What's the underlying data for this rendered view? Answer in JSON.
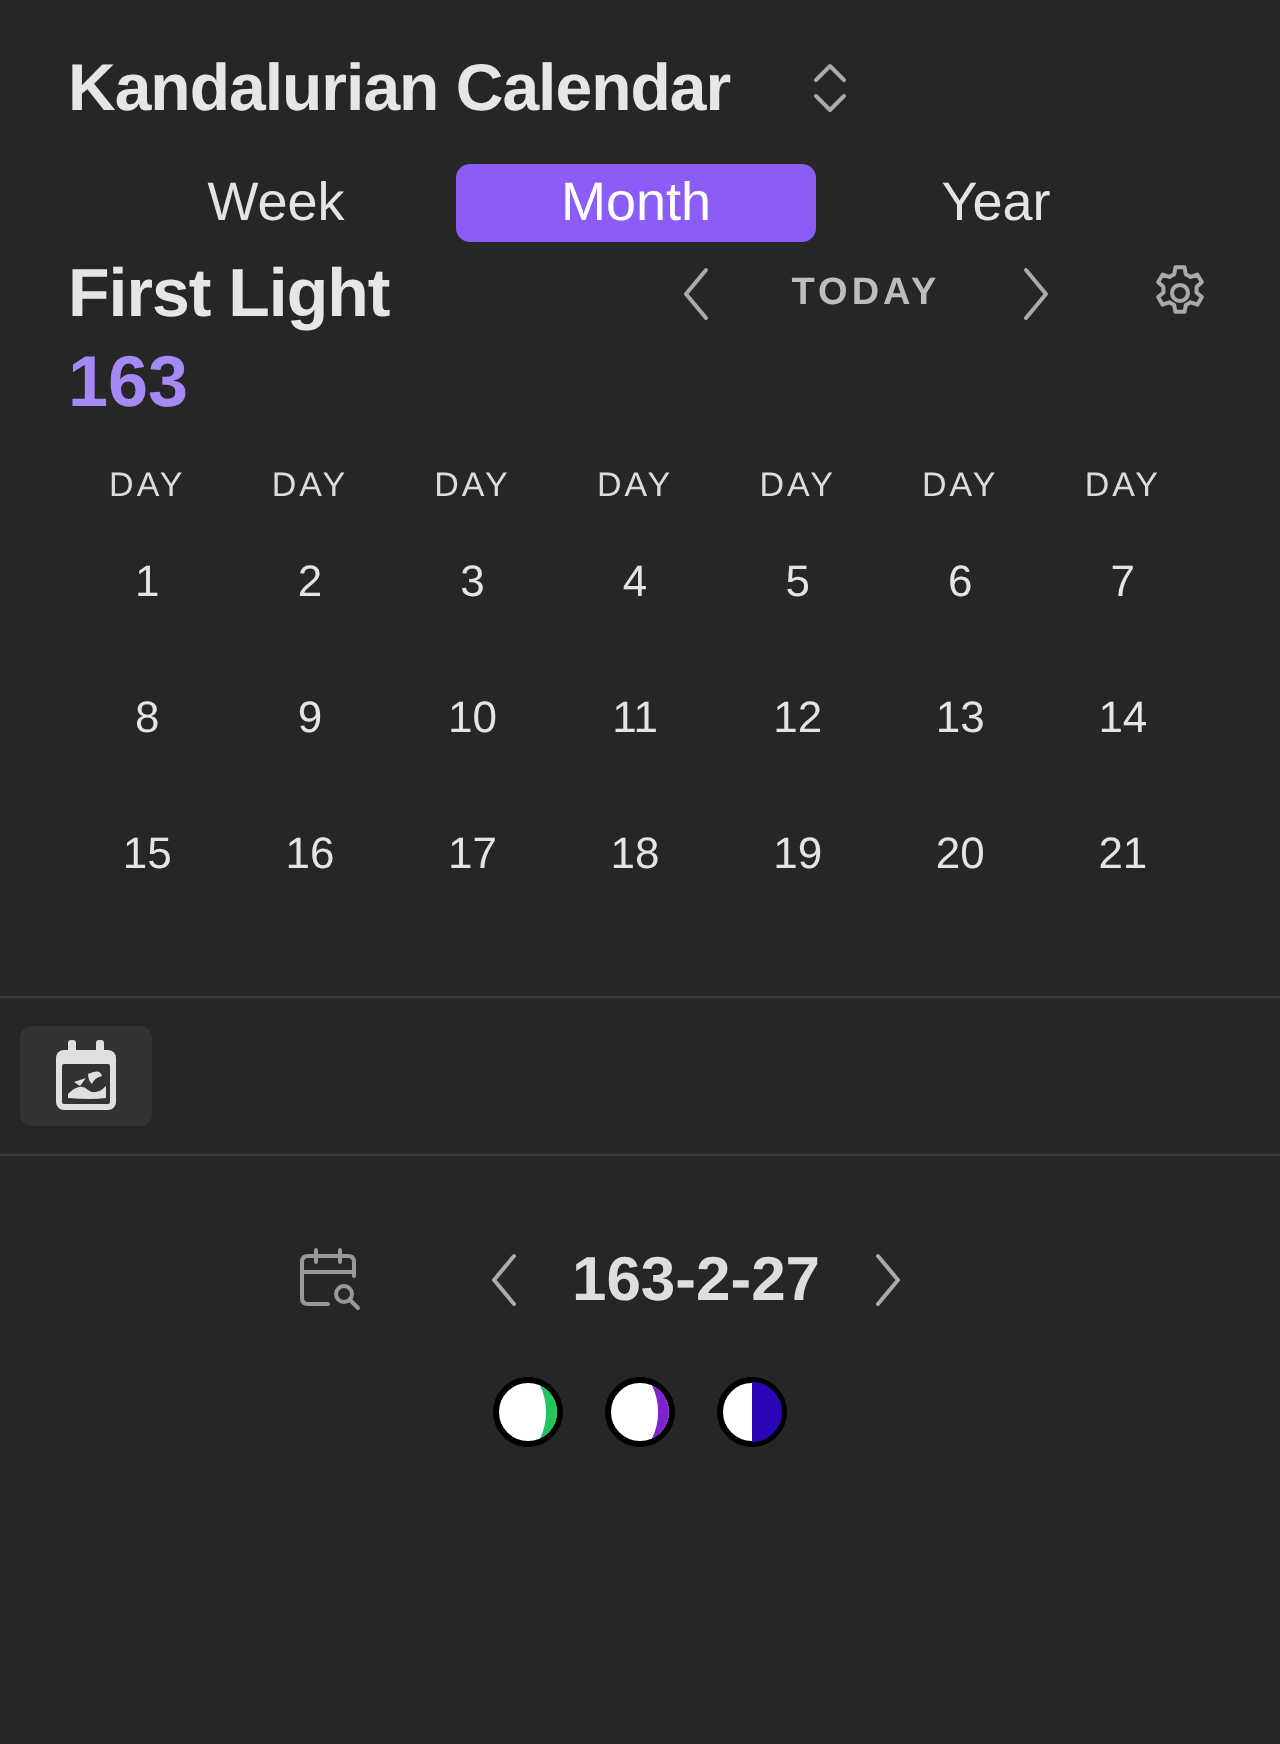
{
  "header": {
    "title": "Kandalurian Calendar"
  },
  "tabs": [
    {
      "label": "Week",
      "selected": false
    },
    {
      "label": "Month",
      "selected": true
    },
    {
      "label": "Year",
      "selected": false
    }
  ],
  "month": {
    "name": "First Light",
    "year": "163",
    "today_label": "TODAY"
  },
  "calendar": {
    "weekdays": [
      "DAY",
      "DAY",
      "DAY",
      "DAY",
      "DAY",
      "DAY",
      "DAY"
    ],
    "weeks": [
      [
        "1",
        "2",
        "3",
        "4",
        "5",
        "6",
        "7"
      ],
      [
        "8",
        "9",
        "10",
        "11",
        "12",
        "13",
        "14"
      ],
      [
        "15",
        "16",
        "17",
        "18",
        "19",
        "20",
        "21"
      ]
    ]
  },
  "footer": {
    "date": "163-2-27",
    "moons": [
      {
        "kind": "sliver",
        "color": "#22c55e"
      },
      {
        "kind": "sliver",
        "color": "#7e22ce"
      },
      {
        "kind": "half",
        "color": "#2a06b8"
      }
    ]
  }
}
